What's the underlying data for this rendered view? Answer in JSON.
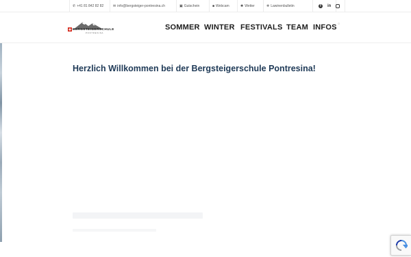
{
  "topbar": {
    "phone": "+41 81 842 82 82",
    "email": "info@bergsteiger-pontresina.ch",
    "gutschein": "Gutschein",
    "webcam": "Webcam",
    "wetter": "Wetter",
    "lawinen": "Lawinenbulletin"
  },
  "nav": {
    "sommer": "SOMMER",
    "winter": "WINTER",
    "festivals": "FESTIVALS",
    "team": "TEAM",
    "infos": "INFOS"
  },
  "logo": {
    "text": "BERGSTEIGERSCHULE",
    "subtext": "PONTRESINA"
  },
  "main": {
    "welcome": "Herzlich Willkommen bei der Bergsteigerschule Pontresina!"
  },
  "icons": {
    "phone": "phone-icon",
    "email": "envelope-icon",
    "gift": "gift-icon",
    "webcam": "video-icon",
    "weather": "sun-icon",
    "avalanche": "snowflake-icon",
    "facebook": "facebook-icon",
    "linkedin": "linkedin-icon",
    "instagram": "instagram-icon",
    "recaptcha": "recaptcha-icon"
  },
  "colors": {
    "title": "#1f3a57",
    "swiss_red": "#d52b1e",
    "nav_text": "#1c1c1c"
  }
}
